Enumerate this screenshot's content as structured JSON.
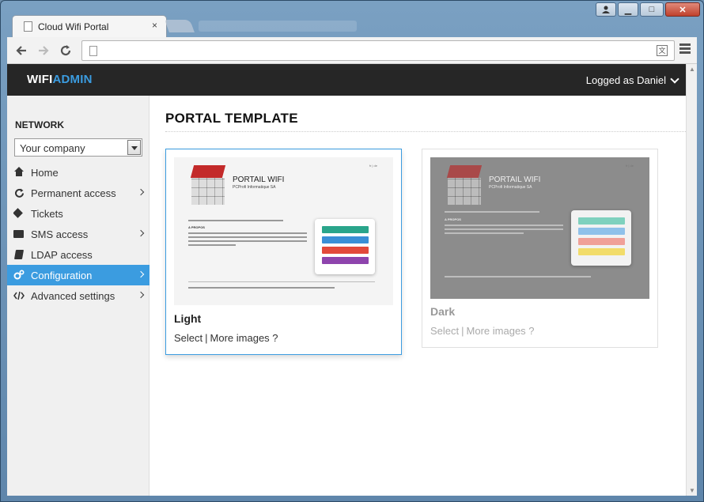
{
  "browser": {
    "tab_title": "Cloud Wifi Portal",
    "tab_close": "×",
    "window_controls": {
      "minimize": "▁",
      "maximize": "□",
      "close": "✕"
    },
    "url": ""
  },
  "header": {
    "brand_part1": "WIFI",
    "brand_part2": "ADMIN",
    "user_menu": "Logged as Daniel"
  },
  "sidebar": {
    "heading": "NETWORK",
    "company_select": {
      "value": "Your company"
    },
    "items": [
      {
        "label": "Home",
        "icon": "home-icon",
        "submenu": false,
        "active": false
      },
      {
        "label": "Permanent access",
        "icon": "refresh-icon",
        "submenu": true,
        "active": false
      },
      {
        "label": "Tickets",
        "icon": "tag-icon",
        "submenu": false,
        "active": false
      },
      {
        "label": "SMS access",
        "icon": "envelope-icon",
        "submenu": true,
        "active": false
      },
      {
        "label": "LDAP access",
        "icon": "book-icon",
        "submenu": false,
        "active": false
      },
      {
        "label": "Configuration",
        "icon": "cogs-icon",
        "submenu": true,
        "active": true
      },
      {
        "label": "Advanced settings",
        "icon": "code-icon",
        "submenu": true,
        "active": false
      }
    ]
  },
  "main": {
    "title": "PORTAL TEMPLATE",
    "templates": [
      {
        "name": "Light",
        "select_label": "Select",
        "separator": "|",
        "more_label": "More images ?",
        "preview_title": "PORTAIL WIFI",
        "preview_subtitle": "PCProfi Informatique SA",
        "preview_lang": "fr | de",
        "preview_section": "A PROPOS",
        "preview_buttons": [
          "#2aa58b",
          "#3a8fd6",
          "#e2493b",
          "#8e44ad"
        ]
      },
      {
        "name": "Dark",
        "select_label": "Select",
        "separator": "|",
        "more_label": "More images ?",
        "preview_title": "PORTAIL WIFI",
        "preview_subtitle": "PCProfi Informatique SA",
        "preview_lang": "fr | de",
        "preview_section": "A PROPOS",
        "preview_buttons": [
          "#7fd1be",
          "#8fc1ea",
          "#f0a098",
          "#f2dc6a"
        ]
      }
    ]
  },
  "colors": {
    "accent": "#3b9ce0",
    "header_bg": "#262626",
    "sidebar_bg": "#f0f0f0"
  }
}
